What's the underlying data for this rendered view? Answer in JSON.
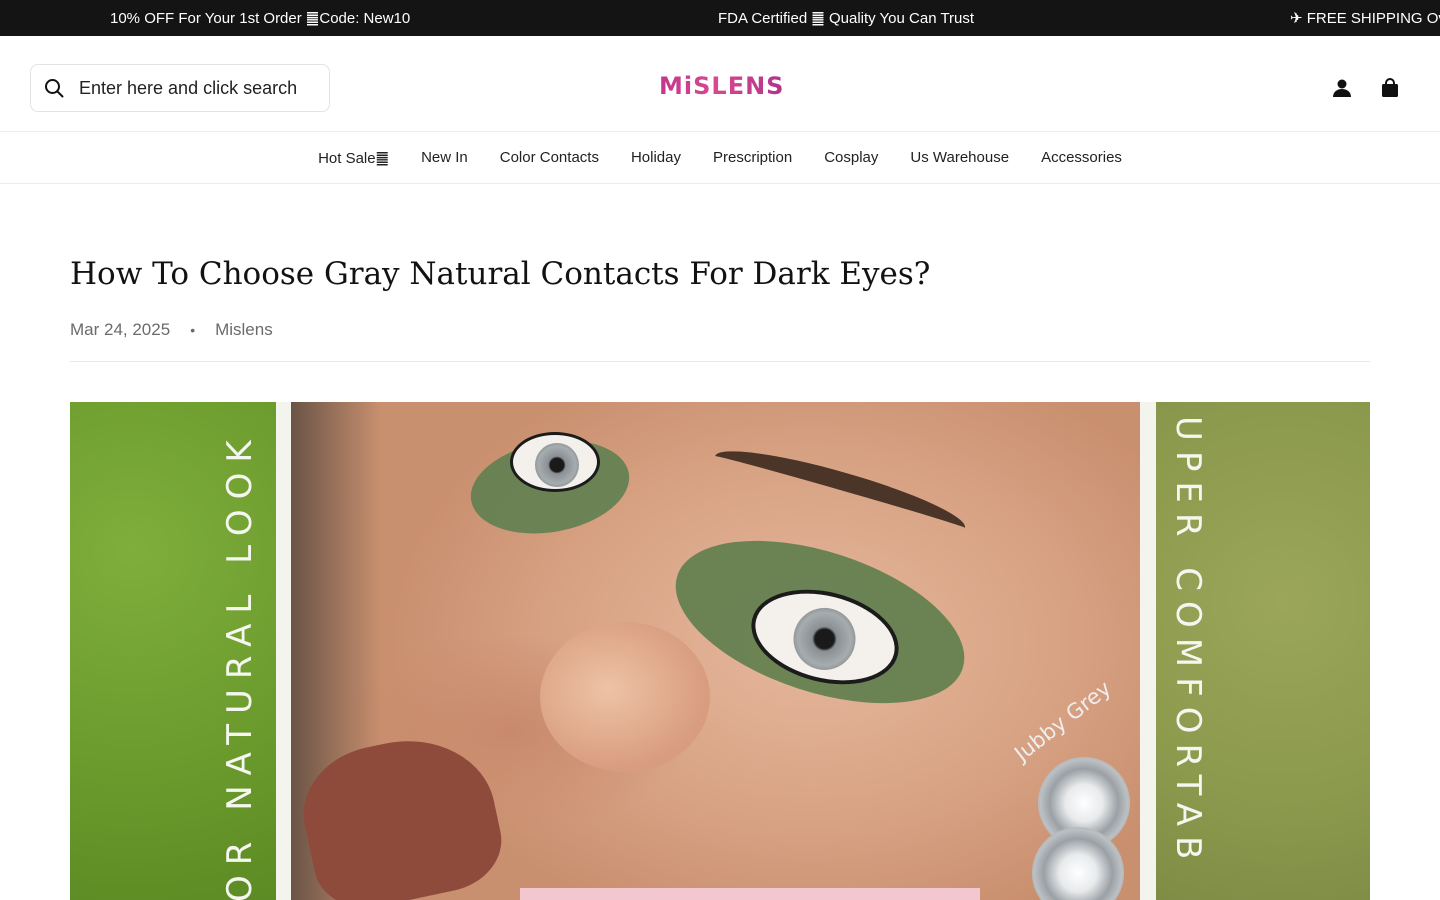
{
  "announcement": {
    "items": [
      "10% OFF For Your 1st Order ䷀Code: New10",
      "FDA Certified ䷀ Quality You Can Trust",
      "✈ FREE SHIPPING Ov"
    ]
  },
  "header": {
    "search_placeholder": "Enter here and click search",
    "logo": "MiSLENS",
    "icons": {
      "account": "account-icon",
      "cart": "cart-icon",
      "search": "search-icon"
    }
  },
  "nav": {
    "items": [
      "Hot Sale䷀",
      "New In",
      "Color Contacts",
      "Holiday",
      "Prescription",
      "Cosplay",
      "Us Warehouse",
      "Accessories"
    ]
  },
  "article": {
    "title": "How To Choose Gray Natural Contacts For Dark Eyes?",
    "date": "Mar 24, 2025",
    "separator": "•",
    "author": "Mislens",
    "hero": {
      "left_text": "OR NATURAL LOOK",
      "right_text": "UPER COMFORTAB",
      "lens_label": "Jubby Grey"
    }
  },
  "colors": {
    "announcement_bg": "#141414",
    "logo_gradient": [
      "#c2378f",
      "#d9488f",
      "#b1338c"
    ],
    "text": "#121212",
    "meta_text": "#6b6b6b"
  }
}
